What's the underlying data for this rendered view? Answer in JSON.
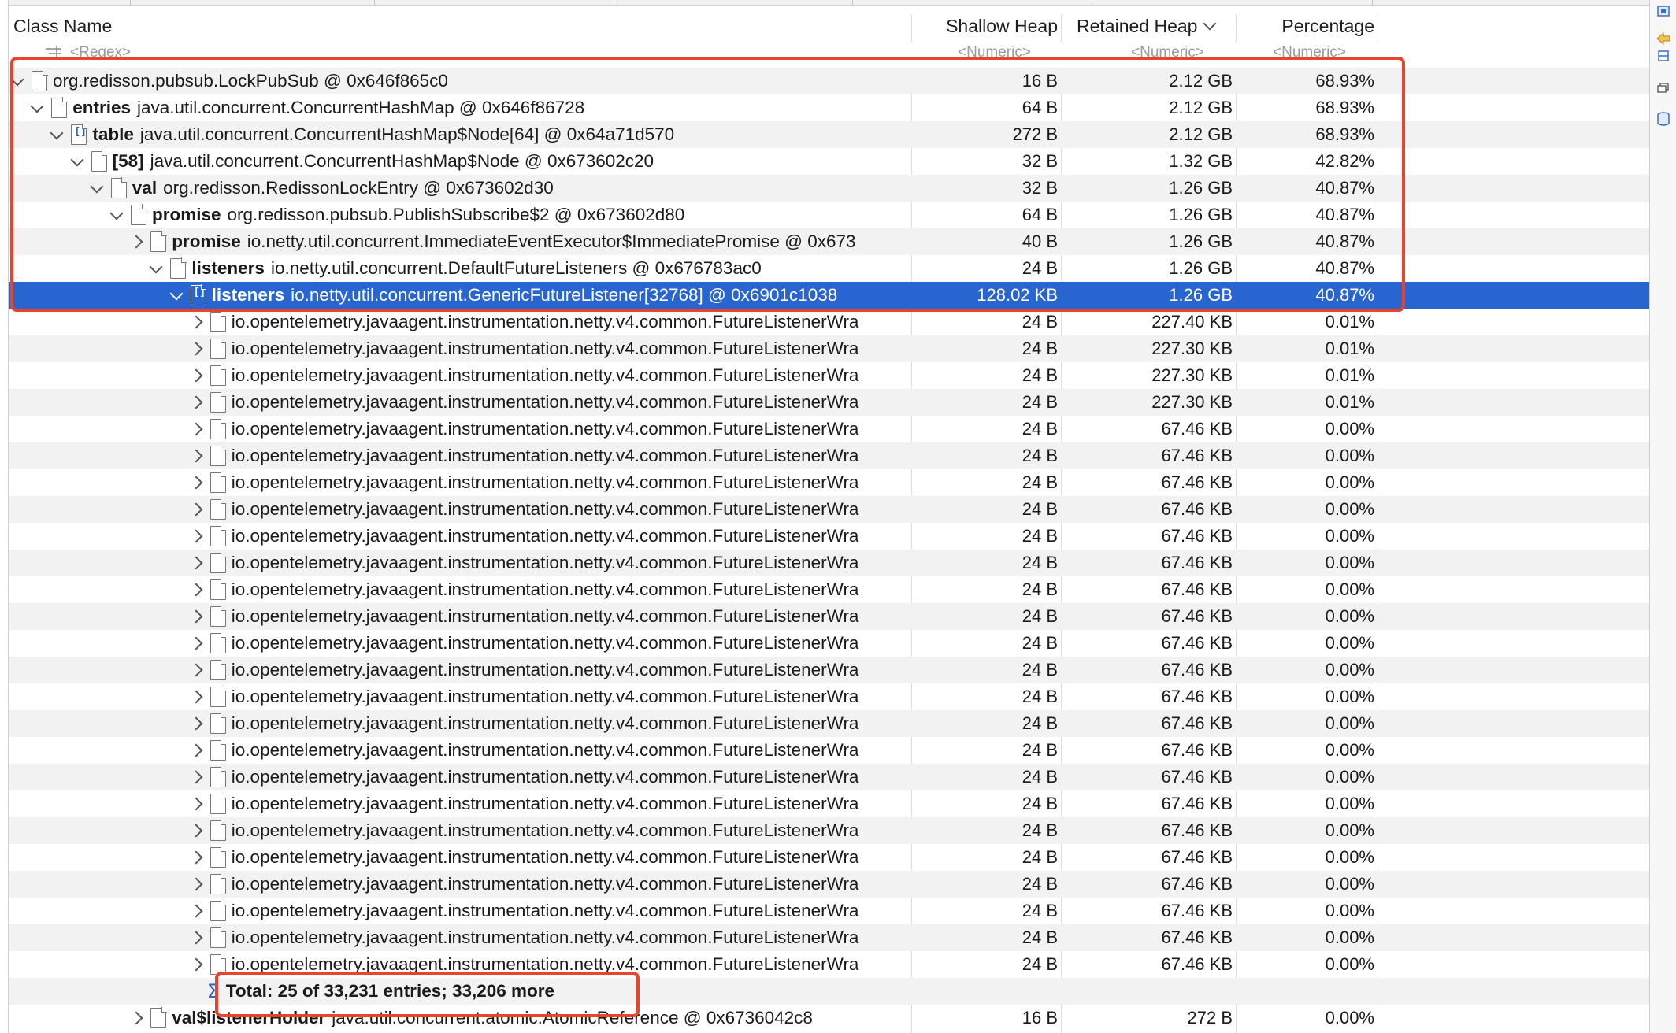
{
  "columns": {
    "class_name": "Class Name",
    "shallow_heap": "Shallow Heap",
    "retained_heap": "Retained Heap",
    "percentage": "Percentage"
  },
  "filter": {
    "class_name": "<Regex>",
    "shallow_heap": "<Numeric>",
    "retained_heap": "<Numeric>",
    "percentage": "<Numeric>"
  },
  "rows": [
    {
      "field": "",
      "type": "org.redisson.pubsub.LockPubSub @ 0x646f865c0",
      "shallow": "16 B",
      "retained": "2.12 GB",
      "pct": "68.93%"
    },
    {
      "field": "entries",
      "type": "java.util.concurrent.ConcurrentHashMap @ 0x646f86728",
      "shallow": "64 B",
      "retained": "2.12 GB",
      "pct": "68.93%"
    },
    {
      "field": "table",
      "type": "java.util.concurrent.ConcurrentHashMap$Node[64] @ 0x64a71d570",
      "shallow": "272 B",
      "retained": "2.12 GB",
      "pct": "68.93%"
    },
    {
      "field": "[58]",
      "type": "java.util.concurrent.ConcurrentHashMap$Node @ 0x673602c20",
      "shallow": "32 B",
      "retained": "1.32 GB",
      "pct": "42.82%"
    },
    {
      "field": "val",
      "type": "org.redisson.RedissonLockEntry @ 0x673602d30",
      "shallow": "32 B",
      "retained": "1.26 GB",
      "pct": "40.87%"
    },
    {
      "field": "promise",
      "type": "org.redisson.pubsub.PublishSubscribe$2 @ 0x673602d80",
      "shallow": "64 B",
      "retained": "1.26 GB",
      "pct": "40.87%"
    },
    {
      "field": "promise",
      "type": "io.netty.util.concurrent.ImmediateEventExecutor$ImmediatePromise @ 0x673",
      "shallow": "40 B",
      "retained": "1.26 GB",
      "pct": "40.87%"
    },
    {
      "field": "listeners",
      "type": "io.netty.util.concurrent.DefaultFutureListeners @ 0x676783ac0",
      "shallow": "24 B",
      "retained": "1.26 GB",
      "pct": "40.87%"
    },
    {
      "field": "listeners",
      "type": "io.netty.util.concurrent.GenericFutureListener[32768] @ 0x6901c1038",
      "shallow": "128.02 KB",
      "retained": "1.26 GB",
      "pct": "40.87%"
    },
    {
      "field": "",
      "type": "io.opentelemetry.javaagent.instrumentation.netty.v4.common.FutureListenerWra",
      "shallow": "24 B",
      "retained": "227.40 KB",
      "pct": "0.01%"
    },
    {
      "field": "",
      "type": "io.opentelemetry.javaagent.instrumentation.netty.v4.common.FutureListenerWra",
      "shallow": "24 B",
      "retained": "227.30 KB",
      "pct": "0.01%"
    },
    {
      "field": "",
      "type": "io.opentelemetry.javaagent.instrumentation.netty.v4.common.FutureListenerWra",
      "shallow": "24 B",
      "retained": "227.30 KB",
      "pct": "0.01%"
    },
    {
      "field": "",
      "type": "io.opentelemetry.javaagent.instrumentation.netty.v4.common.FutureListenerWra",
      "shallow": "24 B",
      "retained": "227.30 KB",
      "pct": "0.01%"
    },
    {
      "field": "",
      "type": "io.opentelemetry.javaagent.instrumentation.netty.v4.common.FutureListenerWra",
      "shallow": "24 B",
      "retained": "67.46 KB",
      "pct": "0.00%"
    },
    {
      "field": "",
      "type": "io.opentelemetry.javaagent.instrumentation.netty.v4.common.FutureListenerWra",
      "shallow": "24 B",
      "retained": "67.46 KB",
      "pct": "0.00%"
    },
    {
      "field": "",
      "type": "io.opentelemetry.javaagent.instrumentation.netty.v4.common.FutureListenerWra",
      "shallow": "24 B",
      "retained": "67.46 KB",
      "pct": "0.00%"
    },
    {
      "field": "",
      "type": "io.opentelemetry.javaagent.instrumentation.netty.v4.common.FutureListenerWra",
      "shallow": "24 B",
      "retained": "67.46 KB",
      "pct": "0.00%"
    },
    {
      "field": "",
      "type": "io.opentelemetry.javaagent.instrumentation.netty.v4.common.FutureListenerWra",
      "shallow": "24 B",
      "retained": "67.46 KB",
      "pct": "0.00%"
    },
    {
      "field": "",
      "type": "io.opentelemetry.javaagent.instrumentation.netty.v4.common.FutureListenerWra",
      "shallow": "24 B",
      "retained": "67.46 KB",
      "pct": "0.00%"
    },
    {
      "field": "",
      "type": "io.opentelemetry.javaagent.instrumentation.netty.v4.common.FutureListenerWra",
      "shallow": "24 B",
      "retained": "67.46 KB",
      "pct": "0.00%"
    },
    {
      "field": "",
      "type": "io.opentelemetry.javaagent.instrumentation.netty.v4.common.FutureListenerWra",
      "shallow": "24 B",
      "retained": "67.46 KB",
      "pct": "0.00%"
    },
    {
      "field": "",
      "type": "io.opentelemetry.javaagent.instrumentation.netty.v4.common.FutureListenerWra",
      "shallow": "24 B",
      "retained": "67.46 KB",
      "pct": "0.00%"
    },
    {
      "field": "",
      "type": "io.opentelemetry.javaagent.instrumentation.netty.v4.common.FutureListenerWra",
      "shallow": "24 B",
      "retained": "67.46 KB",
      "pct": "0.00%"
    },
    {
      "field": "",
      "type": "io.opentelemetry.javaagent.instrumentation.netty.v4.common.FutureListenerWra",
      "shallow": "24 B",
      "retained": "67.46 KB",
      "pct": "0.00%"
    },
    {
      "field": "",
      "type": "io.opentelemetry.javaagent.instrumentation.netty.v4.common.FutureListenerWra",
      "shallow": "24 B",
      "retained": "67.46 KB",
      "pct": "0.00%"
    },
    {
      "field": "",
      "type": "io.opentelemetry.javaagent.instrumentation.netty.v4.common.FutureListenerWra",
      "shallow": "24 B",
      "retained": "67.46 KB",
      "pct": "0.00%"
    },
    {
      "field": "",
      "type": "io.opentelemetry.javaagent.instrumentation.netty.v4.common.FutureListenerWra",
      "shallow": "24 B",
      "retained": "67.46 KB",
      "pct": "0.00%"
    },
    {
      "field": "",
      "type": "io.opentelemetry.javaagent.instrumentation.netty.v4.common.FutureListenerWra",
      "shallow": "24 B",
      "retained": "67.46 KB",
      "pct": "0.00%"
    },
    {
      "field": "",
      "type": "io.opentelemetry.javaagent.instrumentation.netty.v4.common.FutureListenerWra",
      "shallow": "24 B",
      "retained": "67.46 KB",
      "pct": "0.00%"
    },
    {
      "field": "",
      "type": "io.opentelemetry.javaagent.instrumentation.netty.v4.common.FutureListenerWra",
      "shallow": "24 B",
      "retained": "67.46 KB",
      "pct": "0.00%"
    },
    {
      "field": "",
      "type": "io.opentelemetry.javaagent.instrumentation.netty.v4.common.FutureListenerWra",
      "shallow": "24 B",
      "retained": "67.46 KB",
      "pct": "0.00%"
    },
    {
      "field": "",
      "type": "io.opentelemetry.javaagent.instrumentation.netty.v4.common.FutureListenerWra",
      "shallow": "24 B",
      "retained": "67.46 KB",
      "pct": "0.00%"
    },
    {
      "field": "",
      "type": "io.opentelemetry.javaagent.instrumentation.netty.v4.common.FutureListenerWra",
      "shallow": "24 B",
      "retained": "67.46 KB",
      "pct": "0.00%"
    },
    {
      "field": "",
      "type": "io.opentelemetry.javaagent.instrumentation.netty.v4.common.FutureListenerWra",
      "shallow": "24 B",
      "retained": "67.46 KB",
      "pct": "0.00%"
    },
    {
      "field": "",
      "type": "Total: 25 of 33,231 entries; 33,206 more",
      "shallow": "",
      "retained": "",
      "pct": ""
    },
    {
      "field": "val$listenerHolder",
      "type": "java.util.concurrent.atomic.AtomicReference @ 0x6736042c8",
      "shallow": "16 B",
      "retained": "272 B",
      "pct": "0.00%"
    }
  ],
  "tree": {
    "depths": [
      0,
      1,
      2,
      3,
      4,
      5,
      6,
      7,
      8,
      9,
      9,
      9,
      9,
      9,
      9,
      9,
      9,
      9,
      9,
      9,
      9,
      9,
      9,
      9,
      9,
      9,
      9,
      9,
      9,
      9,
      9,
      9,
      9,
      9,
      9,
      6
    ],
    "expanded": [
      true,
      true,
      true,
      true,
      true,
      true,
      false,
      true,
      true,
      false,
      false,
      false,
      false,
      false,
      false,
      false,
      false,
      false,
      false,
      false,
      false,
      false,
      false,
      false,
      false,
      false,
      false,
      false,
      false,
      false,
      false,
      false,
      false,
      false,
      false,
      false
    ],
    "has_twisty": [
      true,
      true,
      true,
      true,
      true,
      true,
      true,
      true,
      true,
      true,
      true,
      true,
      true,
      true,
      true,
      true,
      true,
      true,
      true,
      true,
      true,
      true,
      true,
      true,
      true,
      true,
      true,
      true,
      true,
      true,
      true,
      true,
      true,
      true,
      false,
      true
    ],
    "array_icon": [
      false,
      false,
      true,
      false,
      false,
      false,
      false,
      false,
      true,
      false,
      false,
      false,
      false,
      false,
      false,
      false,
      false,
      false,
      false,
      false,
      false,
      false,
      false,
      false,
      false,
      false,
      false,
      false,
      false,
      false,
      false,
      false,
      false,
      false,
      false,
      false
    ],
    "selected_index": 8,
    "total_row_index": 34
  },
  "icons": {
    "node": "document-icon",
    "array_node": "array-document-icon",
    "total": "sum-icon",
    "expand": "chevron-icon",
    "sort": "chevron-down-icon"
  },
  "colors": {
    "selection": "#2865d1",
    "highlight_box": "#e8442c",
    "alt_row": "#f2f2f2"
  }
}
